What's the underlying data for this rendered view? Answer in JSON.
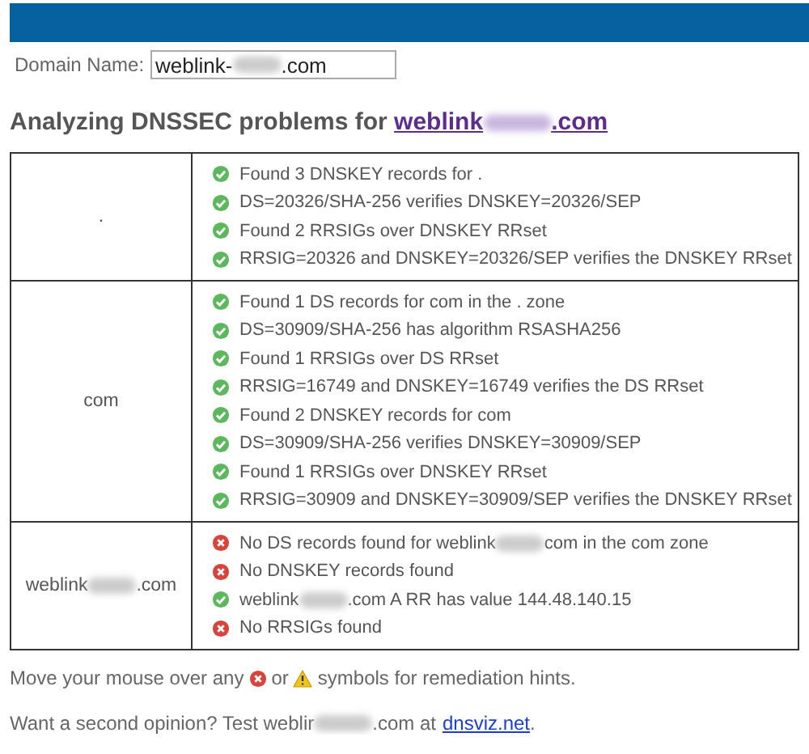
{
  "form": {
    "label": "Domain Name:",
    "value_parts": [
      "weblink-",
      ".com"
    ]
  },
  "heading": {
    "text": "Analyzing DNSSEC problems for",
    "link_parts": [
      "weblink",
      ".com"
    ]
  },
  "zones": [
    {
      "name_parts": [
        "."
      ],
      "results": [
        {
          "kind": "ok",
          "parts": [
            "Found 3 DNSKEY records for ."
          ]
        },
        {
          "kind": "ok",
          "parts": [
            "DS=20326/SHA-256 verifies DNSKEY=20326/SEP"
          ]
        },
        {
          "kind": "ok",
          "parts": [
            "Found 2 RRSIGs over DNSKEY RRset"
          ]
        },
        {
          "kind": "ok",
          "parts": [
            "RRSIG=20326 and DNSKEY=20326/SEP verifies the DNSKEY RRset"
          ]
        }
      ]
    },
    {
      "name_parts": [
        "com"
      ],
      "results": [
        {
          "kind": "ok",
          "parts": [
            "Found 1 DS records for com in the . zone"
          ]
        },
        {
          "kind": "ok",
          "parts": [
            "DS=30909/SHA-256 has algorithm RSASHA256"
          ]
        },
        {
          "kind": "ok",
          "parts": [
            "Found 1 RRSIGs over DS RRset"
          ]
        },
        {
          "kind": "ok",
          "parts": [
            "RRSIG=16749 and DNSKEY=16749 verifies the DS RRset"
          ]
        },
        {
          "kind": "ok",
          "parts": [
            "Found 2 DNSKEY records for com"
          ]
        },
        {
          "kind": "ok",
          "parts": [
            "DS=30909/SHA-256 verifies DNSKEY=30909/SEP"
          ]
        },
        {
          "kind": "ok",
          "parts": [
            "Found 1 RRSIGs over DNSKEY RRset"
          ]
        },
        {
          "kind": "ok",
          "parts": [
            "RRSIG=30909 and DNSKEY=30909/SEP verifies the DNSKEY RRset"
          ]
        }
      ]
    },
    {
      "name_parts": [
        "weblink",
        ".com"
      ],
      "results": [
        {
          "kind": "error",
          "parts": [
            "No DS records found for weblink",
            "com in the com zone"
          ]
        },
        {
          "kind": "error",
          "parts": [
            "No DNSKEY records found"
          ]
        },
        {
          "kind": "ok",
          "parts": [
            "weblink",
            ".com A RR has value 144.48.140.15"
          ]
        },
        {
          "kind": "error",
          "parts": [
            "No RRSIGs found"
          ]
        }
      ]
    }
  ],
  "hint": {
    "before": "Move your mouse over any",
    "middle": "or",
    "after": "symbols for remediation hints."
  },
  "second_opinion": {
    "parts": [
      "Want a second opinion? Test weblir",
      ".com at"
    ],
    "link": "dnsviz.net",
    "end": "."
  }
}
